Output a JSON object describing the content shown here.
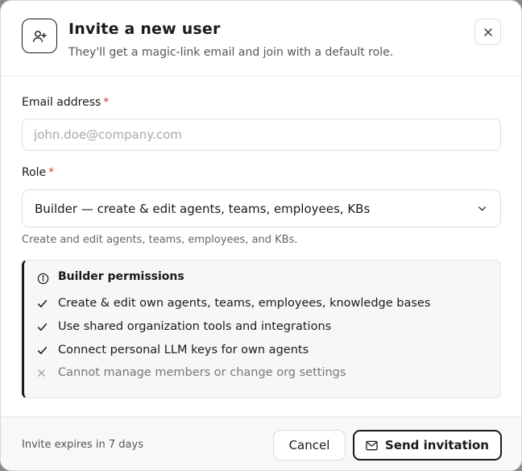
{
  "dialog": {
    "title": "Invite a new user",
    "subtitle": "They'll get a magic-link email and join with a default role.",
    "header_icon": "user-plus-icon",
    "close_icon": "close-icon"
  },
  "email": {
    "label": "Email address",
    "required_mark": "*",
    "placeholder": "john.doe@company.com",
    "value": ""
  },
  "role": {
    "label": "Role",
    "required_mark": "*",
    "selected": "Builder — create & edit agents, teams, employees, KBs",
    "help": "Create and edit agents, teams, employees, and KBs."
  },
  "permissions": {
    "title": "Builder permissions",
    "items": [
      {
        "text": "Create & edit own agents, teams, employees, knowledge bases",
        "allowed": true
      },
      {
        "text": "Use shared organization tools and integrations",
        "allowed": true
      },
      {
        "text": "Connect personal LLM keys for own agents",
        "allowed": true
      },
      {
        "text": "Cannot manage members or change org settings",
        "allowed": false
      }
    ]
  },
  "footer": {
    "expires": "Invite expires in 7 days",
    "cancel_label": "Cancel",
    "send_label": "Send invitation",
    "send_icon": "mail-icon"
  }
}
